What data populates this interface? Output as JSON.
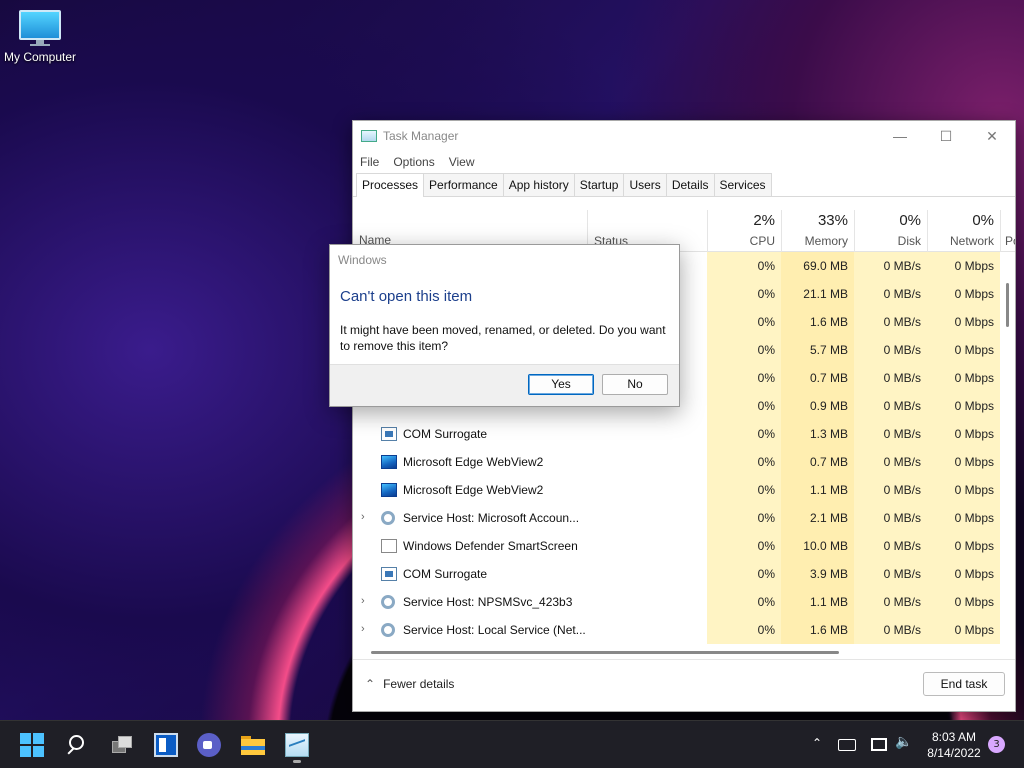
{
  "desktop": {
    "icons": [
      {
        "label": "My Computer",
        "icon": "computer-icon"
      }
    ]
  },
  "task_manager": {
    "title": "Task Manager",
    "menu": [
      "File",
      "Options",
      "View"
    ],
    "tabs": [
      "Processes",
      "Performance",
      "App history",
      "Startup",
      "Users",
      "Details",
      "Services"
    ],
    "active_tab": "Processes",
    "columns": {
      "name": "Name",
      "status": "Status",
      "cpu": {
        "pct": "2%",
        "label": "CPU"
      },
      "memory": {
        "pct": "33%",
        "label": "Memory"
      },
      "disk": {
        "pct": "0%",
        "label": "Disk"
      },
      "network": {
        "pct": "0%",
        "label": "Network"
      },
      "power_partial": "Po"
    },
    "rows": [
      {
        "name": "",
        "icon": "none",
        "expand": false,
        "cpu": "0%",
        "memory": "69.0 MB",
        "disk": "0 MB/s",
        "network": "0 Mbps"
      },
      {
        "name": "",
        "icon": "none",
        "expand": false,
        "cpu": "0%",
        "memory": "21.1 MB",
        "disk": "0 MB/s",
        "network": "0 Mbps"
      },
      {
        "name": "",
        "icon": "none",
        "expand": false,
        "cpu": "0%",
        "memory": "1.6 MB",
        "disk": "0 MB/s",
        "network": "0 Mbps"
      },
      {
        "name": "",
        "icon": "none",
        "expand": false,
        "cpu": "0%",
        "memory": "5.7 MB",
        "disk": "0 MB/s",
        "network": "0 Mbps"
      },
      {
        "name": "",
        "icon": "none",
        "expand": false,
        "cpu": "0%",
        "memory": "0.7 MB",
        "disk": "0 MB/s",
        "network": "0 Mbps"
      },
      {
        "name": "",
        "icon": "none",
        "expand": false,
        "cpu": "0%",
        "memory": "0.9 MB",
        "disk": "0 MB/s",
        "network": "0 Mbps"
      },
      {
        "name": "COM Surrogate",
        "icon": "com",
        "expand": false,
        "cpu": "0%",
        "memory": "1.3 MB",
        "disk": "0 MB/s",
        "network": "0 Mbps"
      },
      {
        "name": "Microsoft Edge WebView2",
        "icon": "edge",
        "expand": false,
        "cpu": "0%",
        "memory": "0.7 MB",
        "disk": "0 MB/s",
        "network": "0 Mbps"
      },
      {
        "name": "Microsoft Edge WebView2",
        "icon": "edge",
        "expand": false,
        "cpu": "0%",
        "memory": "1.1 MB",
        "disk": "0 MB/s",
        "network": "0 Mbps"
      },
      {
        "name": "Service Host: Microsoft Accoun...",
        "icon": "gear",
        "expand": true,
        "cpu": "0%",
        "memory": "2.1 MB",
        "disk": "0 MB/s",
        "network": "0 Mbps"
      },
      {
        "name": "Windows Defender SmartScreen",
        "icon": "blank",
        "expand": false,
        "cpu": "0%",
        "memory": "10.0 MB",
        "disk": "0 MB/s",
        "network": "0 Mbps"
      },
      {
        "name": "COM Surrogate",
        "icon": "com",
        "expand": false,
        "cpu": "0%",
        "memory": "3.9 MB",
        "disk": "0 MB/s",
        "network": "0 Mbps"
      },
      {
        "name": "Service Host: NPSMSvc_423b3",
        "icon": "gear",
        "expand": true,
        "cpu": "0%",
        "memory": "1.1 MB",
        "disk": "0 MB/s",
        "network": "0 Mbps"
      },
      {
        "name": "Service Host: Local Service (Net...",
        "icon": "gear",
        "expand": true,
        "cpu": "0%",
        "memory": "1.6 MB",
        "disk": "0 MB/s",
        "network": "0 Mbps"
      }
    ],
    "footer": {
      "fewer_details": "Fewer details",
      "end_task": "End task"
    }
  },
  "dialog": {
    "title": "Windows",
    "heading": "Can't open this item",
    "message": "It might have been moved, renamed, or deleted. Do you want to remove this item?",
    "yes": "Yes",
    "no": "No"
  },
  "taskbar": {
    "time": "8:03 AM",
    "date": "8/14/2022",
    "notifications": "3"
  }
}
